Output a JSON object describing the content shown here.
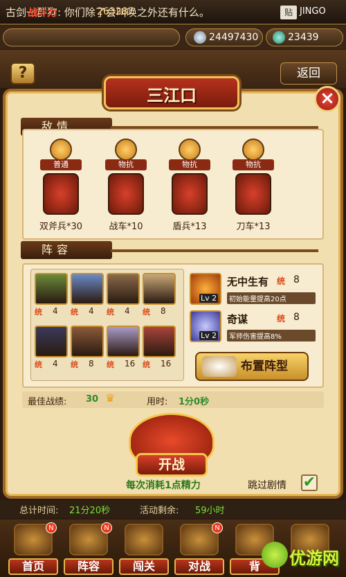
{
  "chat": {
    "message": "古剑一群狗: 你们除了会叫唤之外还有什么。",
    "tag": "贴",
    "nickname": "JINGO"
  },
  "resources": {
    "power_label": "战斗力",
    "power_value": "263287",
    "silver": "24497430",
    "gold": "23439"
  },
  "header": {
    "help": "?",
    "back": "返回"
  },
  "dialog": {
    "title": "三江口",
    "close": "×"
  },
  "enemy": {
    "section_title": "敌情",
    "units": [
      {
        "badge": "普通",
        "name": "双斧兵*30"
      },
      {
        "badge": "物抗",
        "name": "战车*10"
      },
      {
        "badge": "物抗",
        "name": "盾兵*13"
      },
      {
        "badge": "物抗",
        "name": "刀车*13"
      }
    ]
  },
  "lineup": {
    "section_title": "阵容",
    "power_icon": "统",
    "heroes": [
      {
        "power": "4"
      },
      {
        "power": "4"
      },
      {
        "power": "4"
      },
      {
        "power": "8"
      },
      {
        "power": "4"
      },
      {
        "power": "8"
      },
      {
        "power": "16"
      },
      {
        "power": "16"
      }
    ],
    "skills": [
      {
        "level": "Lv 2",
        "name": "无中生有",
        "cost": "8",
        "desc": "初始能量提高20点"
      },
      {
        "level": "Lv 2",
        "name": "奇谋",
        "cost": "8",
        "desc": "军师伤害提高8%"
      }
    ],
    "arrange_button": "布置阵型"
  },
  "best": {
    "label": "最佳战绩:",
    "value": "30",
    "time_label": "用时:",
    "time_value": "1分0秒"
  },
  "start": {
    "button": "开战",
    "cost_note": "每次消耗1点精力",
    "skip_label": "跳过剧情",
    "skip_checked": "✔"
  },
  "status": {
    "total_time_label": "总计时间:",
    "total_time_value": "21分20秒",
    "activity_label": "活动剩余:",
    "activity_value": "59小时"
  },
  "nav": {
    "items": [
      {
        "label": "首页",
        "badge": "N"
      },
      {
        "label": "阵容",
        "badge": "N"
      },
      {
        "label": "闯关",
        "badge": ""
      },
      {
        "label": "对战",
        "badge": "N"
      },
      {
        "label": "背",
        "badge": ""
      },
      {
        "label": "",
        "badge": ""
      }
    ]
  },
  "watermark": {
    "text": "优游网"
  },
  "colors": {
    "panel": "#f2dfb0",
    "frame": "#a06a26",
    "accent_red": "#b5321c",
    "green": "#2a8a2a"
  }
}
